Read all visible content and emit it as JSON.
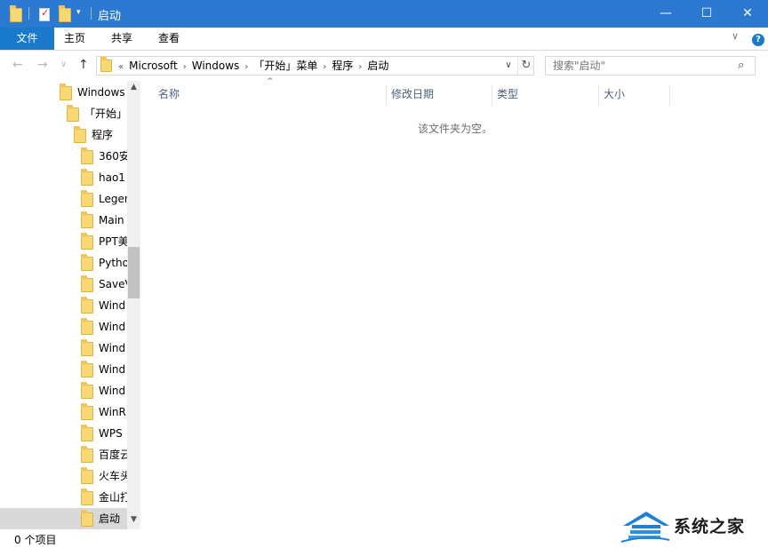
{
  "window": {
    "title": "启动",
    "controls": {
      "minimize": "—",
      "maximize": "☐",
      "close": "✕"
    }
  },
  "quick_access": {
    "dropdown_glyph": "▾"
  },
  "ribbon": {
    "tabs": [
      {
        "label": "文件",
        "active": true
      },
      {
        "label": "主页"
      },
      {
        "label": "共享"
      },
      {
        "label": "查看"
      }
    ],
    "collapse_glyph": "∨",
    "help_glyph": "?"
  },
  "nav": {
    "back_glyph": "←",
    "forward_glyph": "→",
    "recent_glyph": "∨",
    "up_glyph": "↑",
    "address": {
      "overflow": "«",
      "crumbs": [
        "Microsoft",
        "Windows",
        "「开始」菜单",
        "程序",
        "启动"
      ],
      "separator": "›",
      "dropdown_glyph": "∨",
      "refresh_glyph": "↻"
    },
    "search": {
      "placeholder": "搜索\"启动\"",
      "icon_glyph": "⌕"
    }
  },
  "navpane": {
    "items": [
      {
        "label": "Windows",
        "level": 0
      },
      {
        "label": "「开始」",
        "level": 1
      },
      {
        "label": "程序",
        "level": 2
      },
      {
        "label": "360安",
        "level": 3
      },
      {
        "label": "hao1",
        "level": 3
      },
      {
        "label": "Legen",
        "level": 3
      },
      {
        "label": "Main",
        "level": 3
      },
      {
        "label": "PPT美",
        "level": 3
      },
      {
        "label": "Pytho",
        "level": 3
      },
      {
        "label": "SaveV",
        "level": 3
      },
      {
        "label": "Wind",
        "level": 3
      },
      {
        "label": "Wind",
        "level": 3
      },
      {
        "label": "Wind",
        "level": 3
      },
      {
        "label": "Wind",
        "level": 3
      },
      {
        "label": "Wind",
        "level": 3
      },
      {
        "label": "WinR",
        "level": 3
      },
      {
        "label": "WPS",
        "level": 3
      },
      {
        "label": "百度云",
        "level": 3
      },
      {
        "label": "火车头",
        "level": 3
      },
      {
        "label": "金山打",
        "level": 3
      },
      {
        "label": "启动",
        "level": 3,
        "selected": true
      }
    ],
    "scroll_up_glyph": "▲",
    "scroll_down_glyph": "▼"
  },
  "content": {
    "columns": [
      "名称",
      "修改日期",
      "类型",
      "大小"
    ],
    "sort_glyph": "^",
    "empty_message": "该文件夹为空。"
  },
  "status": {
    "item_count": "0 个项目"
  },
  "watermark": {
    "text": "系统之家"
  },
  "colors": {
    "titlebar": "#2b79d0",
    "file_tab": "#1979ca",
    "folder": "#f8d775",
    "selection": "#d9d9d9",
    "header_text": "#4c607a"
  }
}
